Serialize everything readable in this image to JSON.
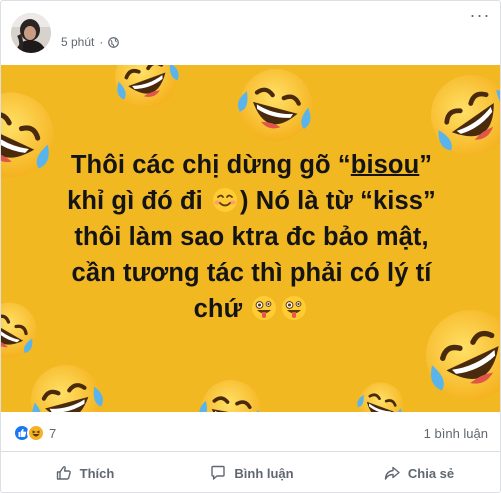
{
  "post": {
    "timestamp": "5 phút",
    "privacy_icon": "globe-icon",
    "more_label": "···"
  },
  "image": {
    "background_color": "#f2b822",
    "emoji_pattern": "face-with-tears-of-joy",
    "text": {
      "line1_a": "Thôi các chị dừng gõ “",
      "line1_underlined": "bisou",
      "line1_b": "”",
      "line2_a": "khỉ gì đó đi",
      "line2_b": ") Nó là từ “kiss”",
      "line3": "thôi làm sao ktra đc bảo mật,",
      "line4": "cần tương tác thì phải có lý tí",
      "line5": "chứ"
    },
    "emoji_icons": [
      "smiling-face-icon",
      "zany-face-icon",
      "zany-face-icon"
    ]
  },
  "reactions": {
    "icons": [
      "like-icon",
      "haha-icon"
    ],
    "count": "7",
    "comments": "1 bình luận"
  },
  "actions": {
    "like": "Thích",
    "comment": "Bình luận",
    "share": "Chia sẻ"
  },
  "colors": {
    "like_blue": "#1877f2",
    "haha_yellow": "#f7b125",
    "meta_gray": "#606770"
  }
}
